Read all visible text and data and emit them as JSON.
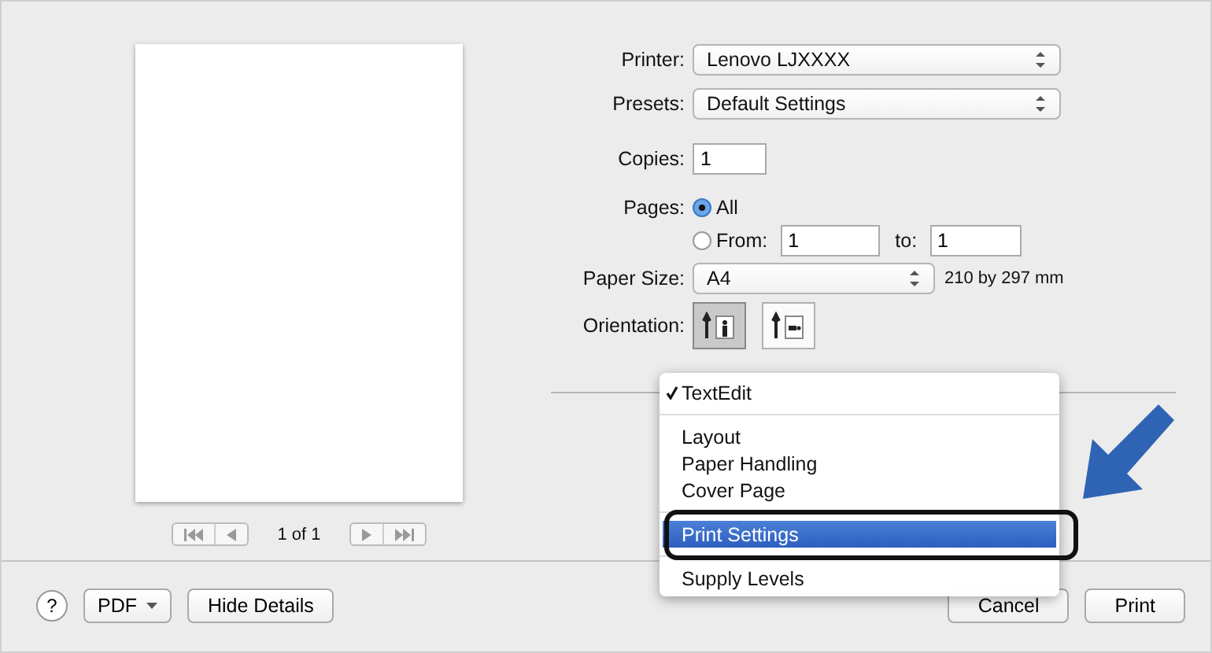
{
  "preview": {
    "page_label": "1 of 1"
  },
  "form": {
    "printer": {
      "label": "Printer:",
      "value": "Lenovo LJXXXX"
    },
    "presets": {
      "label": "Presets:",
      "value": "Default Settings"
    },
    "copies": {
      "label": "Copies:",
      "value": "1"
    },
    "pages": {
      "label": "Pages:",
      "options": [
        {
          "label": "All",
          "selected": true
        },
        {
          "label": "From:",
          "selected": false
        }
      ],
      "from_value": "1",
      "to_label": "to:",
      "to_value": "1"
    },
    "paper_size": {
      "label": "Paper Size:",
      "value": "A4",
      "dimensions": "210 by 297 mm"
    },
    "orientation": {
      "label": "Orientation:",
      "options": [
        {
          "kind": "portrait",
          "selected": true
        },
        {
          "kind": "landscape",
          "selected": false
        }
      ]
    }
  },
  "menu": {
    "items": [
      {
        "kind": "item",
        "label": "TextEdit",
        "checked": true,
        "selected": false
      },
      {
        "kind": "separator"
      },
      {
        "kind": "item",
        "label": "Layout",
        "checked": false,
        "selected": false
      },
      {
        "kind": "item",
        "label": "Paper Handling",
        "checked": false,
        "selected": false
      },
      {
        "kind": "item",
        "label": "Cover Page",
        "checked": false,
        "selected": false
      },
      {
        "kind": "separator"
      },
      {
        "kind": "item",
        "label": "Print Settings",
        "checked": false,
        "selected": true
      },
      {
        "kind": "separator"
      },
      {
        "kind": "item",
        "label": "Supply Levels",
        "checked": false,
        "selected": false
      }
    ]
  },
  "footer": {
    "help": "?",
    "pdf": "PDF",
    "hide_details": "Hide Details",
    "cancel": "Cancel",
    "print": "Print"
  }
}
